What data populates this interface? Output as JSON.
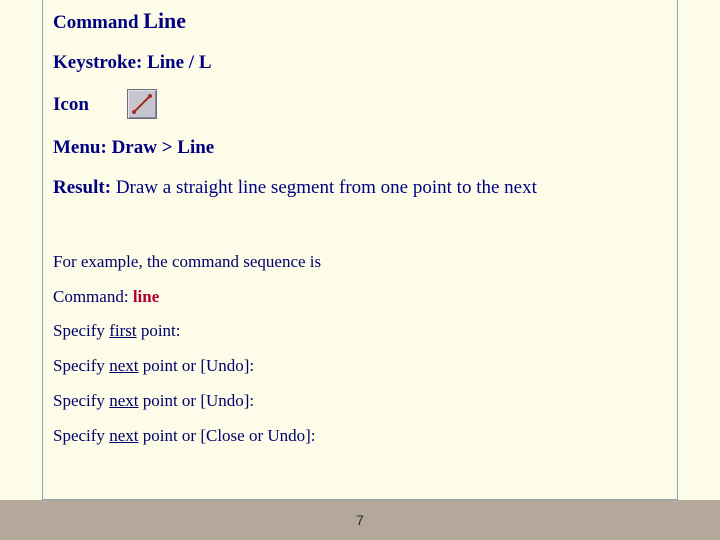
{
  "heading": {
    "prefix": "Command ",
    "big": "Line"
  },
  "keystroke": {
    "label": "Keystroke: ",
    "value": "Line / L"
  },
  "icon": {
    "label": "Icon",
    "name": "line-icon"
  },
  "menu": {
    "label": "Menu: ",
    "value": "Draw > Line"
  },
  "result": {
    "label": "Result: ",
    "value": "Draw a straight line segment from one point to the next"
  },
  "example": {
    "intro": "For example, the command sequence is",
    "command_label": "Command: ",
    "command_name": "line",
    "prompts": [
      {
        "pre": "Specify ",
        "u": "first",
        "post": " point:"
      },
      {
        "pre": "Specify ",
        "u": "next",
        "post": " point or [Undo]:"
      },
      {
        "pre": "Specify ",
        "u": "next",
        "post": " point or [Undo]:"
      },
      {
        "pre": "Specify ",
        "u": "next",
        "post": " point or [Close or Undo]:"
      }
    ]
  },
  "page_number": "7"
}
